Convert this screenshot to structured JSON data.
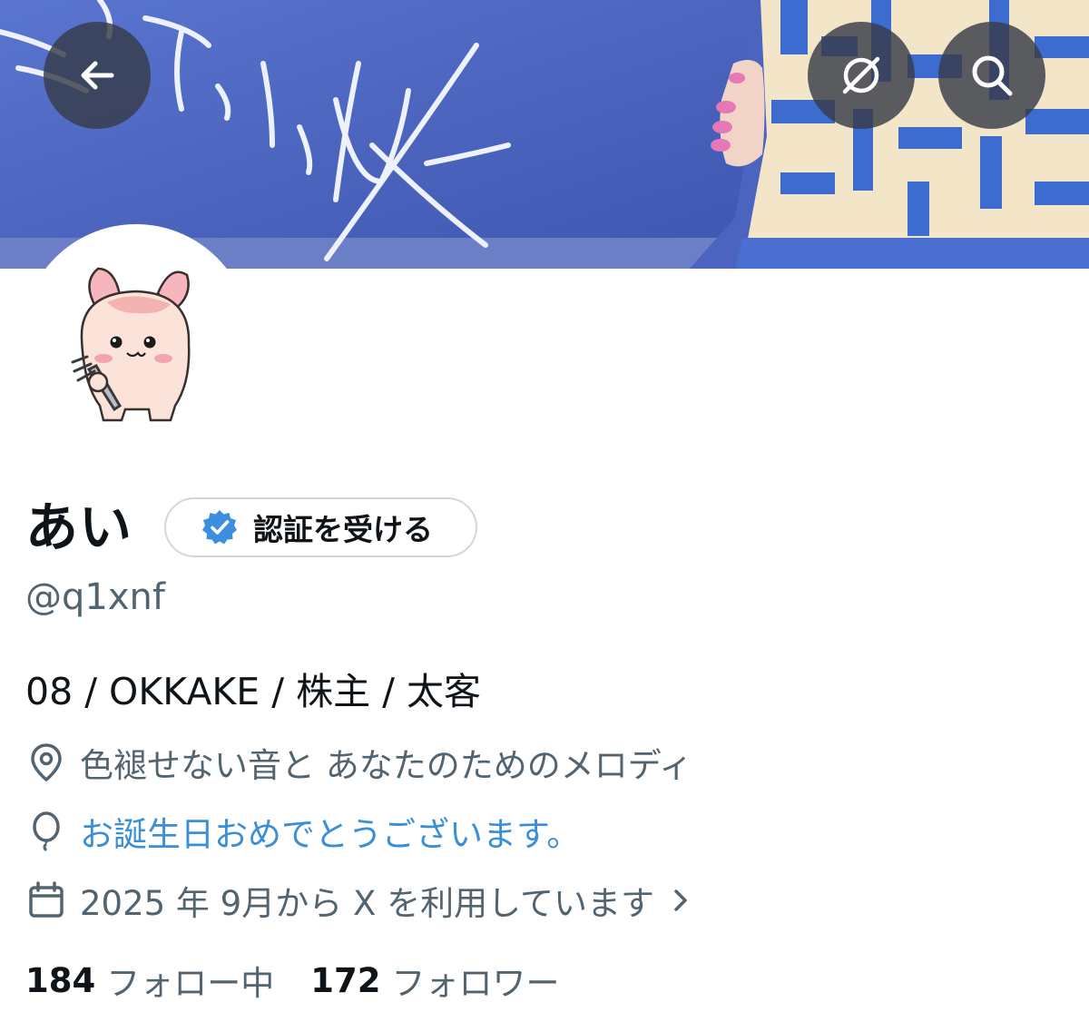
{
  "header": {
    "back_icon": "arrow-left-icon",
    "translate_icon": "translate-icon",
    "search_icon": "search-icon",
    "button_bg": "#373c48"
  },
  "banner": {
    "description_colors": {
      "towel": "#4c67c1",
      "cream": "#f3e6c8",
      "nails": "#e47bb4"
    }
  },
  "profile": {
    "display_name": "あい",
    "verify_button_label": "認証を受ける",
    "verified_badge_color": "#3b8fde",
    "handle": "@q1xnf",
    "bio": "08 / OKKAKE / 株主 / 太客",
    "location": "色褪せない音と あなたのためのメロディ",
    "birthday": "お誕生日おめでとうございます。",
    "joined": "2025 年 9月から X を利用しています",
    "following_count": "184",
    "following_label": "フォロー中",
    "followers_count": "172",
    "followers_label": "フォロワー"
  },
  "colors": {
    "text_primary": "#0f1419",
    "text_secondary": "#536471",
    "link": "#3a8fd6",
    "border": "#cfd9de"
  }
}
